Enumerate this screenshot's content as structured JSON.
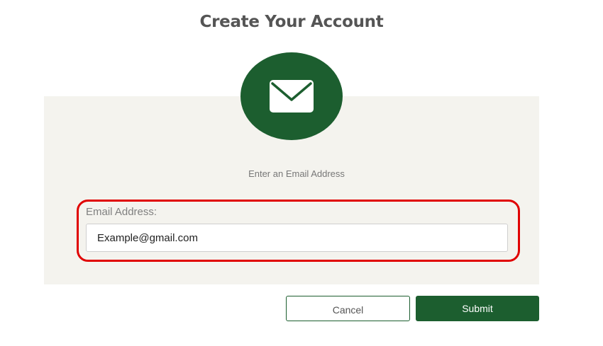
{
  "page": {
    "title": "Create Your Account"
  },
  "badge": {
    "icon": "envelope-icon",
    "color": "#1c5e2f"
  },
  "form": {
    "prompt": "Enter an Email Address",
    "email_label": "Email Address:",
    "email_value": "Example@gmail.com",
    "highlight_color": "#e00000"
  },
  "actions": {
    "cancel_label": "Cancel",
    "submit_label": "Submit"
  }
}
